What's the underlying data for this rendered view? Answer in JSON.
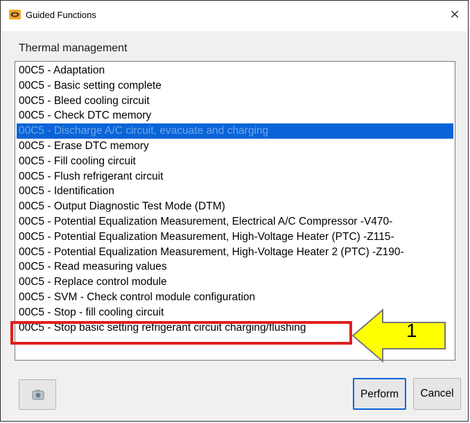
{
  "window": {
    "title": "Guided Functions",
    "close_glyph": "×"
  },
  "group_label": "Thermal management",
  "list": {
    "selected_index": 4,
    "highlighted_index": 18,
    "items": [
      "00C5 - Adaptation",
      "00C5 - Basic setting complete",
      "00C5 - Bleed cooling circuit",
      "00C5 - Check DTC memory",
      "00C5 - Discharge A/C circuit, evacuate and charging",
      "00C5 - Erase DTC memory",
      "00C5 - Fill cooling circuit",
      "00C5 - Flush refrigerant circuit",
      "00C5 - Identification",
      "00C5 - Output Diagnostic Test Mode (DTM)",
      "00C5 - Potential Equalization Measurement, Electrical A/C Compressor -V470-",
      "00C5 - Potential Equalization Measurement, High-Voltage Heater (PTC) -Z115-",
      "00C5 - Potential Equalization Measurement, High-Voltage Heater 2 (PTC) -Z190-",
      "00C5 - Read measuring values",
      "00C5 - Replace control module",
      "00C5 - SVM - Check control module configuration",
      "00C5 - Stop - fill cooling circuit",
      "00C5 - Stop basic setting refrigerant circuit charging/flushing"
    ]
  },
  "callout": {
    "number": "1"
  },
  "buttons": {
    "screenshot_icon": "camera-icon",
    "perform": "Perform",
    "cancel": "Cancel"
  },
  "colors": {
    "selection": "#0a64d8",
    "highlight_box": "#e01e1e",
    "callout_arrow": "#ffff00"
  }
}
